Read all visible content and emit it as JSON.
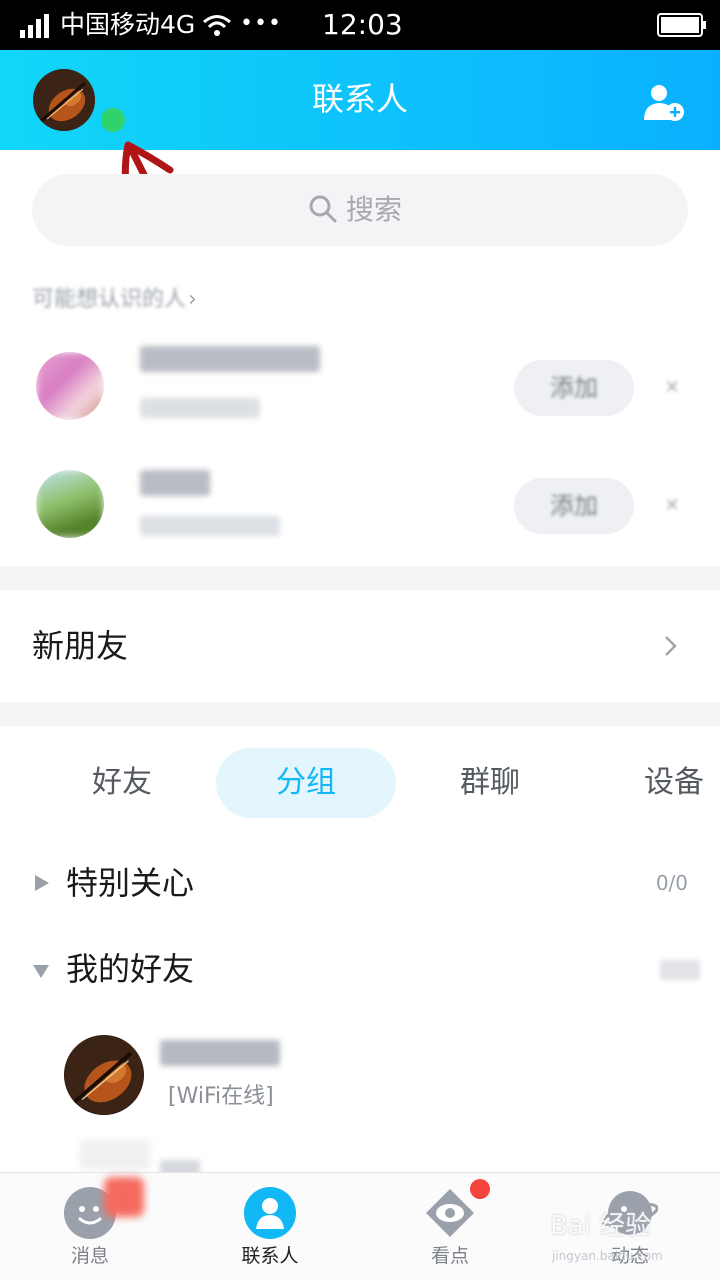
{
  "status_bar": {
    "carrier": "中国移动4G",
    "dots": "•••",
    "time": "12:03"
  },
  "header": {
    "title": "联系人"
  },
  "search": {
    "placeholder": "搜索"
  },
  "may_know": {
    "title": "可能想认识的人",
    "add_label": "添加"
  },
  "new_friends": {
    "label": "新朋友"
  },
  "tabs": [
    {
      "label": "好友",
      "active": false
    },
    {
      "label": "分组",
      "active": true
    },
    {
      "label": "群聊",
      "active": false
    },
    {
      "label": "设备",
      "active": false
    }
  ],
  "groups": [
    {
      "name": "特别关心",
      "count": "0/0",
      "expanded": false
    },
    {
      "name": "我的好友",
      "expanded": true
    }
  ],
  "friend": {
    "status": "[WiFi在线]"
  },
  "bottom_nav": [
    {
      "label": "消息",
      "icon": "message-icon"
    },
    {
      "label": "联系人",
      "icon": "contacts-icon",
      "active": true
    },
    {
      "label": "看点",
      "icon": "eye-icon"
    },
    {
      "label": "动态",
      "icon": "planet-icon"
    }
  ],
  "watermark": {
    "text": "Bai 经验",
    "sub": "jingyan.baidu.com"
  },
  "colors": {
    "header_start": "#12d6f7",
    "header_end": "#0ab0ff",
    "accent": "#12b7f5",
    "online": "#2fd36b",
    "badge": "#f5443b"
  }
}
